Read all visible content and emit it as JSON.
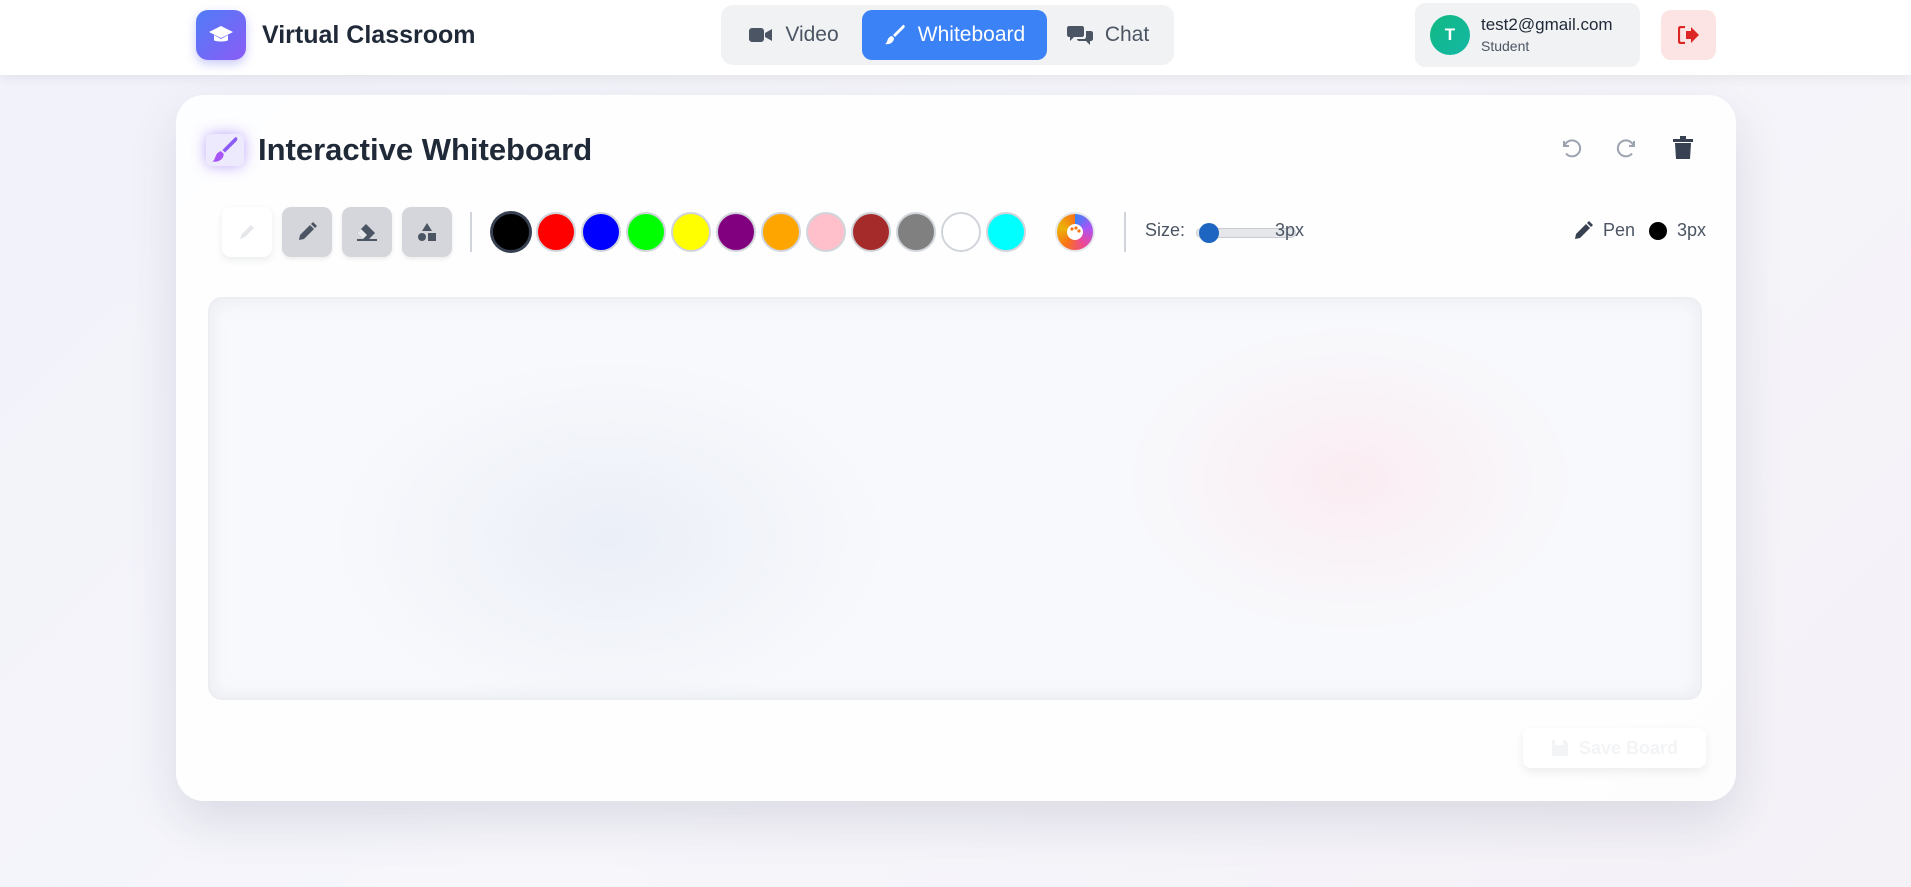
{
  "app": {
    "title": "Virtual Classroom",
    "logo_icon": "graduation-cap-icon"
  },
  "nav": {
    "tabs": [
      {
        "label": "Video",
        "icon": "video-camera-icon",
        "active": false
      },
      {
        "label": "Whiteboard",
        "icon": "paintbrush-icon",
        "active": true
      },
      {
        "label": "Chat",
        "icon": "chat-bubbles-icon",
        "active": false
      }
    ]
  },
  "user": {
    "initial": "T",
    "email": "test2@gmail.com",
    "role": "Student",
    "logout_icon": "sign-out-icon"
  },
  "whiteboard": {
    "title": "Interactive Whiteboard",
    "title_icon": "paintbrush-icon",
    "actions": [
      "undo-icon",
      "redo-icon",
      "trash-icon"
    ],
    "tools": [
      {
        "name": "select",
        "icon": "pen-outline-icon",
        "active": true
      },
      {
        "name": "pen",
        "icon": "pen-icon",
        "active": false
      },
      {
        "name": "eraser",
        "icon": "eraser-icon",
        "active": false
      },
      {
        "name": "shapes",
        "icon": "shapes-icon",
        "active": false
      }
    ],
    "colors": [
      "#000000",
      "#ff0000",
      "#0000ff",
      "#00ff00",
      "#ffff00",
      "#800080",
      "#ffa500",
      "#ffc0cb",
      "#a52a2a",
      "#808080",
      "#ffffff",
      "#00ffff"
    ],
    "selected_color": "#000000",
    "custom_color_icon": "palette-icon",
    "size_label": "Size:",
    "size_value": "3px",
    "size_min": 1,
    "size_max": 50,
    "size": 3,
    "status_tool": "Pen",
    "status_size": "3px",
    "save_label": "Save Board",
    "save_icon": "floppy-disk-icon"
  },
  "colors": {
    "accent": "#3b82f6",
    "avatar": "#10b981",
    "logout_bg": "#fde4e4",
    "logout_icon": "#dc2626"
  }
}
